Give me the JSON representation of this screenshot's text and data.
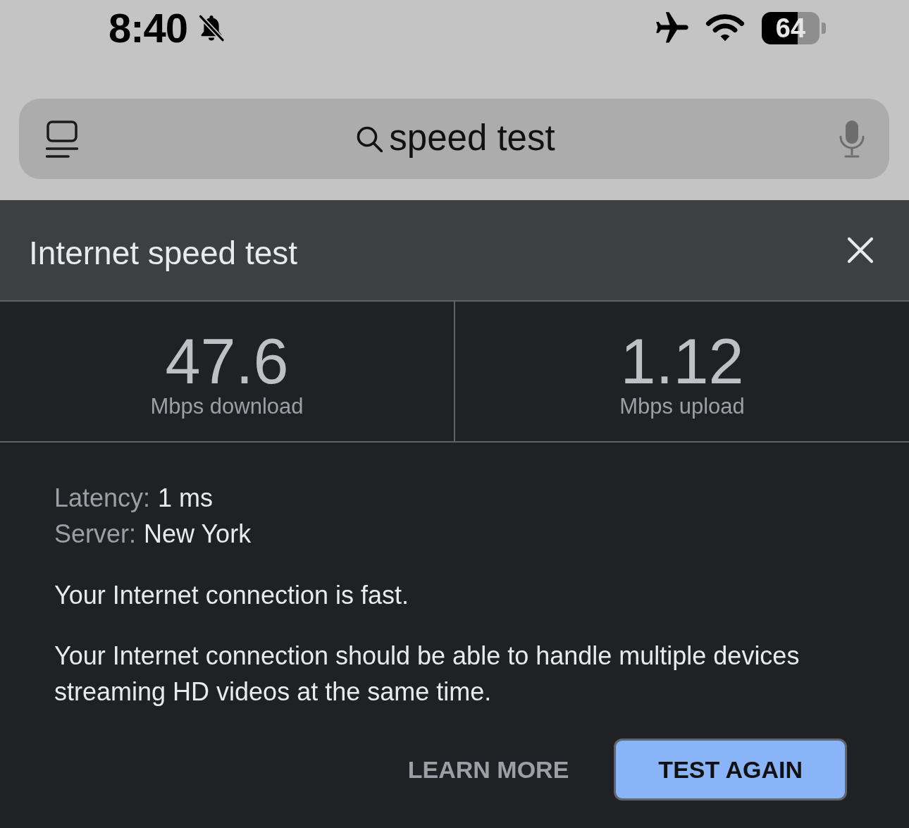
{
  "status_bar": {
    "time": "8:40",
    "silent": true,
    "airplane_mode": true,
    "battery": "64"
  },
  "search_bar": {
    "value": "speed test"
  },
  "panel": {
    "title": "Internet speed test"
  },
  "results": [
    {
      "value": "47.6",
      "unit": "Mbps download"
    },
    {
      "value": "1.12",
      "unit": "Mbps upload"
    }
  ],
  "details": [
    {
      "label": "Latency:",
      "value": "1 ms"
    },
    {
      "label": "Server:",
      "value": "New York"
    }
  ],
  "verdict": "Your Internet connection is fast.",
  "description": "Your Internet connection should be able to handle multiple devices streaming HD videos at the same time.",
  "buttons": [
    {
      "label": "LEARN MORE",
      "kind": "text"
    },
    {
      "label": "TEST AGAIN",
      "kind": "filled"
    }
  ]
}
